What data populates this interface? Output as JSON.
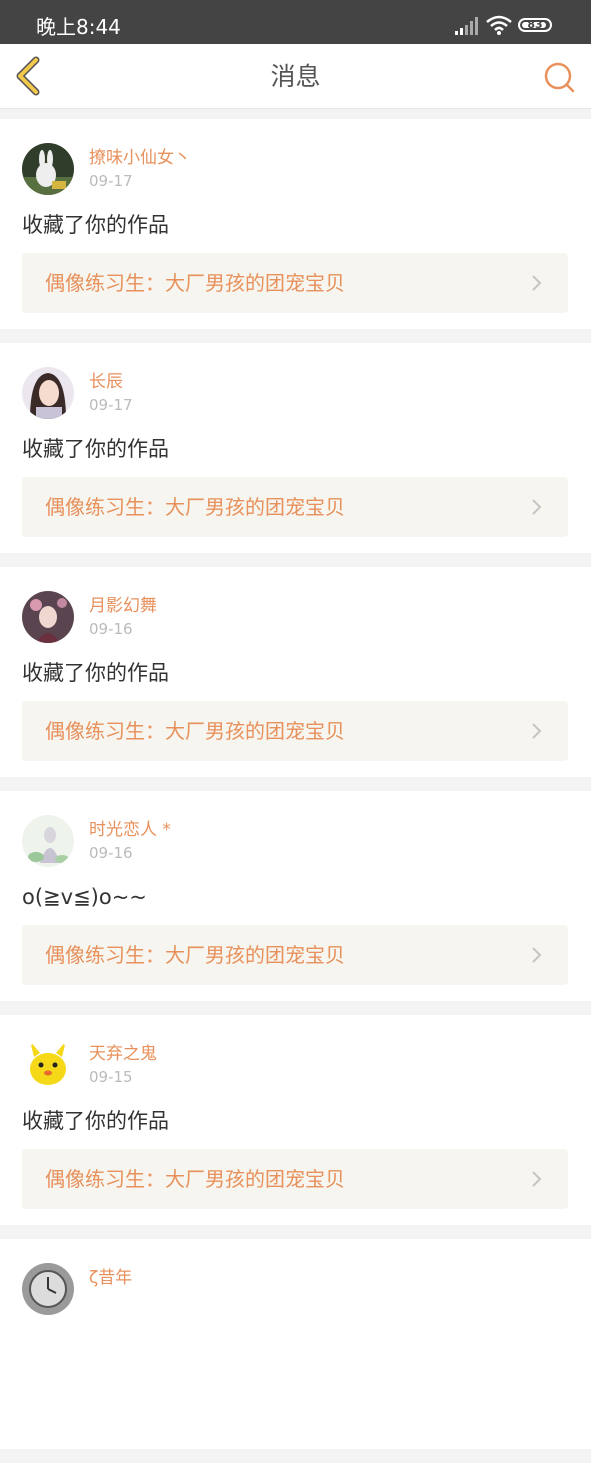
{
  "status_bar": {
    "time": "晚上8:44",
    "battery": "83"
  },
  "header": {
    "title": "消息"
  },
  "messages": [
    {
      "user": "撩味小仙女丶",
      "date": "09-17",
      "text": "收藏了你的作品",
      "work": "偶像练习生：大厂男孩的团宠宝贝"
    },
    {
      "user": "长辰",
      "date": "09-17",
      "text": "收藏了你的作品",
      "work": "偶像练习生：大厂男孩的团宠宝贝"
    },
    {
      "user": "月影幻舞",
      "date": "09-16",
      "text": "收藏了你的作品",
      "work": "偶像练习生：大厂男孩的团宠宝贝"
    },
    {
      "user": "时光恋人 *",
      "date": "09-16",
      "text": "o(≧v≦)o~~",
      "work": "偶像练习生：大厂男孩的团宠宝贝"
    },
    {
      "user": "天弃之鬼",
      "date": "09-15",
      "text": "收藏了你的作品",
      "work": "偶像练习生：大厂男孩的团宠宝贝"
    },
    {
      "user": "ζ昔年",
      "date": "",
      "text": "",
      "work": ""
    }
  ],
  "colors": {
    "accent": "#e8915c",
    "back_icon": "#f2c94c",
    "status_bar": "#444444"
  }
}
